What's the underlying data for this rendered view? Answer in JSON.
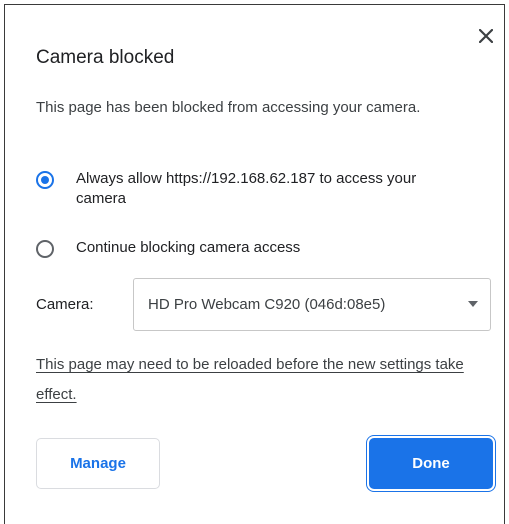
{
  "dialog": {
    "title": "Camera blocked",
    "description": "This page has been blocked from accessing your camera.",
    "close_icon": "close-icon"
  },
  "options": [
    {
      "label": "Always allow https://192.168.62.187 to access your camera",
      "checked": true
    },
    {
      "label": "Continue blocking camera access",
      "checked": false
    }
  ],
  "camera": {
    "label": "Camera:",
    "selected": "HD Pro Webcam C920 (046d:08e5)",
    "caret_icon": "chevron-down-icon"
  },
  "reload_notice": "This page may need to be reloaded before the new settings take effect.",
  "buttons": {
    "manage": "Manage",
    "done": "Done"
  },
  "colors": {
    "accent": "#1a73e8",
    "text": "#202124",
    "border": "#dadce0"
  }
}
